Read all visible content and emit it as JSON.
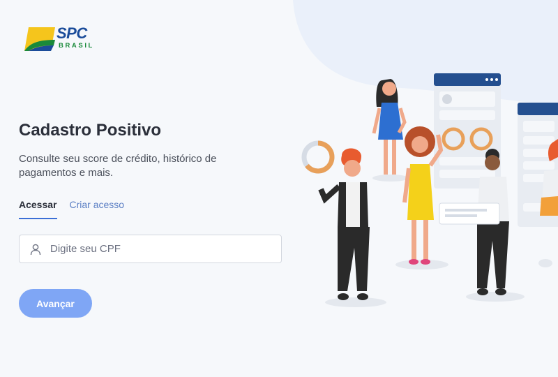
{
  "brand": {
    "name": "SPC",
    "sub": "BRASIL",
    "blue": "#1b4c9a",
    "green": "#1a8a3a",
    "yellow": "#f5c51c"
  },
  "page": {
    "title": "Cadastro Positivo",
    "subtitle": "Consulte seu score de crédito, histórico de pagamentos e mais."
  },
  "tabs": [
    {
      "label": "Acessar",
      "active": true
    },
    {
      "label": "Criar acesso",
      "active": false
    }
  ],
  "cpf": {
    "placeholder": "Digite seu CPF",
    "value": "",
    "icon": "user-icon"
  },
  "submit": {
    "label": "Avançar"
  },
  "colors": {
    "accent": "#3b6fd6",
    "button": "#7fa6f5",
    "link": "#5b7fc4"
  }
}
